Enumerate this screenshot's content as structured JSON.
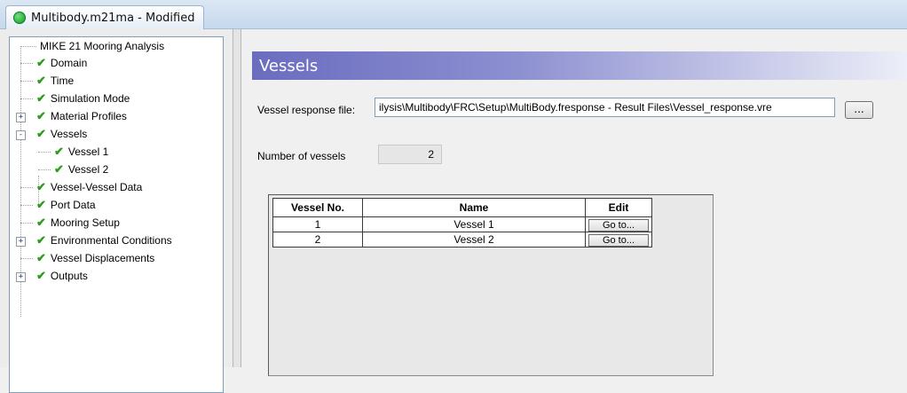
{
  "window": {
    "title": "Multibody.m21ma - Modified"
  },
  "tree": {
    "items": [
      {
        "label": "MIKE 21 Mooring Analysis",
        "checked": false,
        "expander": ""
      },
      {
        "label": "Domain",
        "checked": true,
        "expander": ""
      },
      {
        "label": "Time",
        "checked": true,
        "expander": ""
      },
      {
        "label": "Simulation Mode",
        "checked": true,
        "expander": ""
      },
      {
        "label": "Material Profiles",
        "checked": true,
        "expander": "+"
      },
      {
        "label": "Vessels",
        "checked": true,
        "expander": "-"
      },
      {
        "label": "Vessel 1",
        "checked": true,
        "expander": ""
      },
      {
        "label": "Vessel 2",
        "checked": true,
        "expander": ""
      },
      {
        "label": "Vessel-Vessel Data",
        "checked": true,
        "expander": ""
      },
      {
        "label": "Port Data",
        "checked": true,
        "expander": ""
      },
      {
        "label": "Mooring Setup",
        "checked": true,
        "expander": ""
      },
      {
        "label": "Environmental Conditions",
        "checked": true,
        "expander": "+"
      },
      {
        "label": "Vessel Displacements",
        "checked": true,
        "expander": ""
      },
      {
        "label": "Outputs",
        "checked": true,
        "expander": "+"
      }
    ]
  },
  "panel": {
    "header": "Vessels",
    "response_label": "Vessel response file:",
    "response_value": "ilysis\\Multibody\\FRC\\Setup\\MultiBody.fresponse - Result Files\\Vessel_response.vre",
    "browse_label": "...",
    "count_label": "Number of vessels",
    "count_value": "2"
  },
  "table": {
    "headers": [
      "Vessel No.",
      "Name",
      "Edit"
    ],
    "rows": [
      {
        "no": "1",
        "name": "Vessel 1",
        "edit": "Go to..."
      },
      {
        "no": "2",
        "name": "Vessel 2",
        "edit": "Go to..."
      }
    ]
  },
  "colors": {
    "header_start": "#6a6cbf",
    "check": "#2e9b1e"
  }
}
